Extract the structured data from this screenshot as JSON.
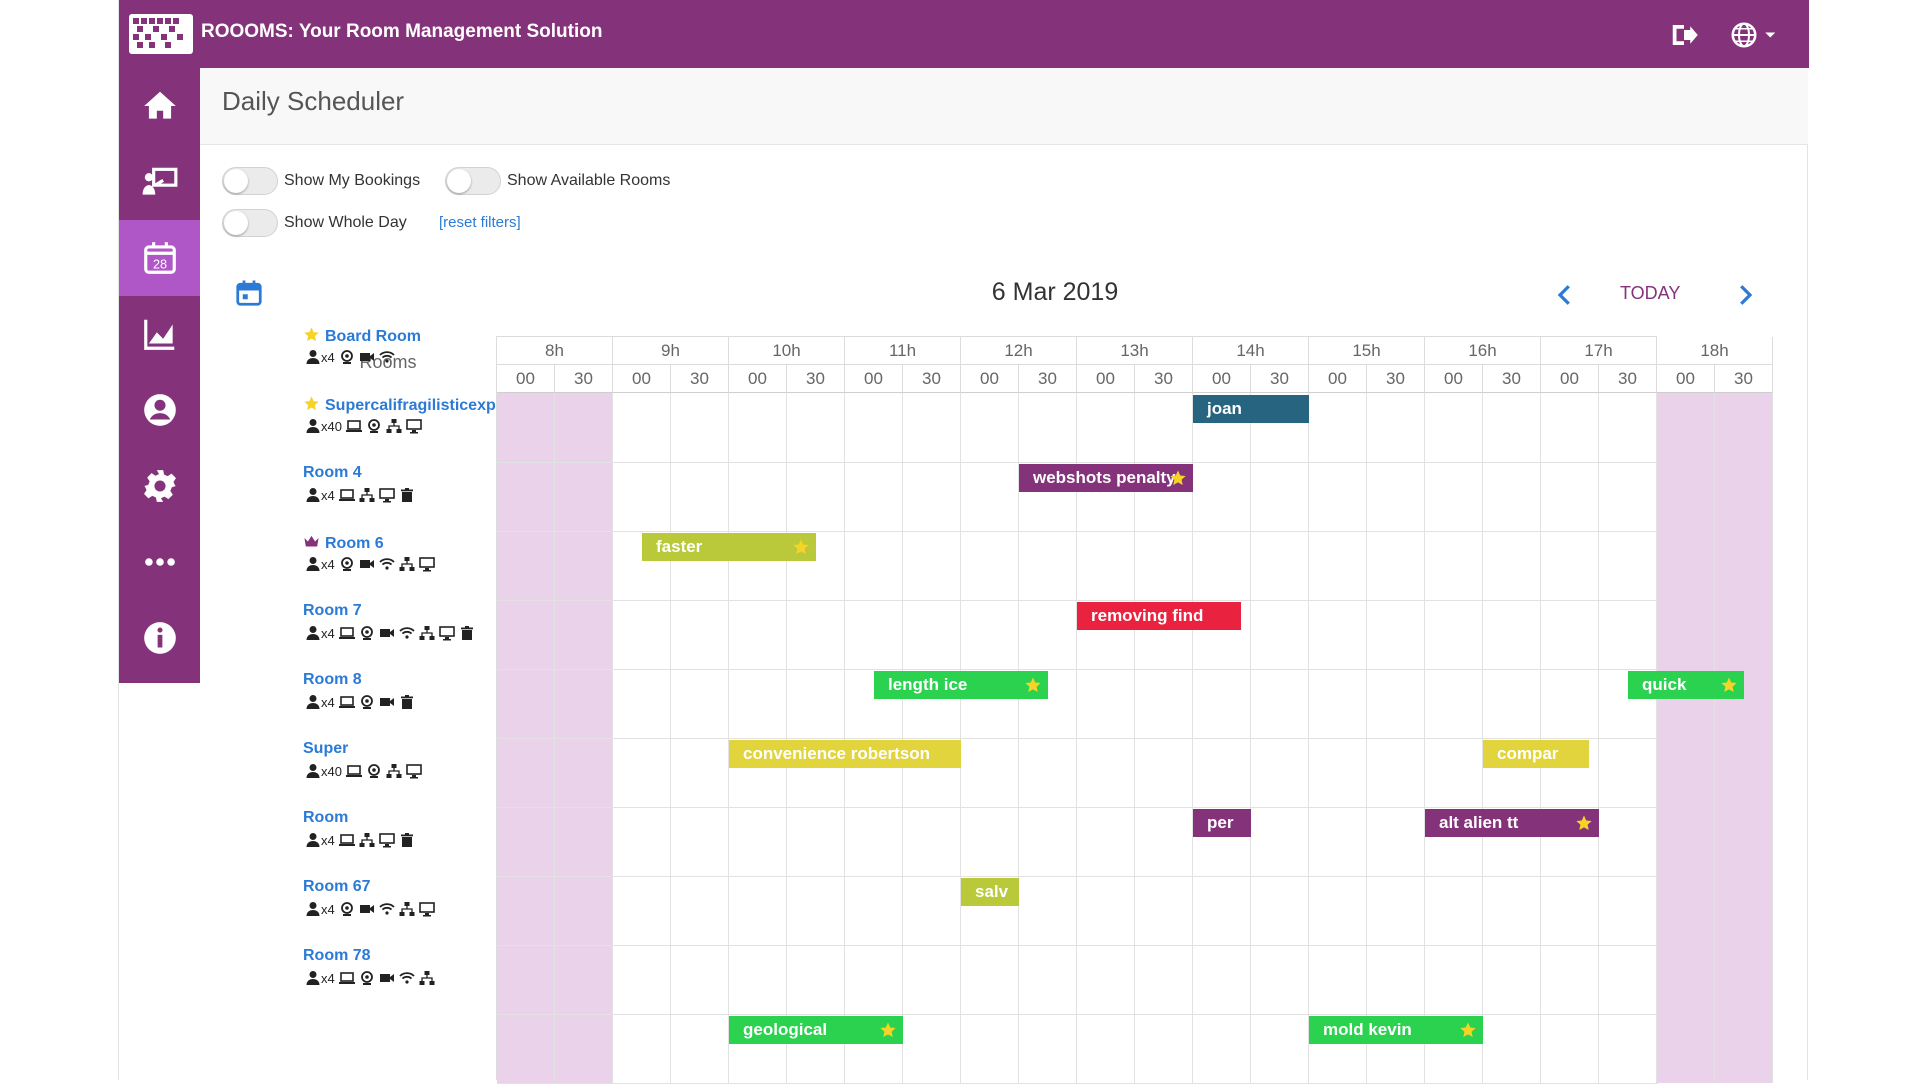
{
  "app": {
    "title": "ROOOMS: Your Room Management Solution"
  },
  "page": {
    "title": "Daily Scheduler"
  },
  "filters": {
    "show_my_bookings": "Show My Bookings",
    "show_available_rooms": "Show Available Rooms",
    "show_whole_day": "Show Whole Day",
    "reset": "[reset filters]"
  },
  "date": "6 Mar 2019",
  "nav": {
    "today": "TODAY",
    "calendar_day": "28"
  },
  "schedule": {
    "rooms_header": "Rooms",
    "hours": [
      "8h",
      "9h",
      "10h",
      "11h",
      "12h",
      "13h",
      "14h",
      "15h",
      "16h",
      "17h",
      "18h"
    ],
    "minutes": [
      "00",
      "30"
    ]
  },
  "rooms": [
    {
      "name": "Board Room",
      "capacity": "x4",
      "marker": "star",
      "features": [
        "webcam",
        "video",
        "wifi"
      ]
    },
    {
      "name": "Supercalifragilisticexpiali...",
      "capacity": "x40",
      "marker": "star",
      "features": [
        "laptop",
        "webcam",
        "network",
        "monitor"
      ]
    },
    {
      "name": "Room 4",
      "capacity": "x4",
      "marker": "",
      "features": [
        "laptop",
        "network",
        "monitor",
        "trash"
      ]
    },
    {
      "name": "Room 6",
      "capacity": "x4",
      "marker": "crown",
      "features": [
        "webcam",
        "video",
        "wifi",
        "network",
        "monitor"
      ]
    },
    {
      "name": "Room 7",
      "capacity": "x4",
      "marker": "",
      "features": [
        "laptop",
        "webcam",
        "video",
        "wifi",
        "network",
        "monitor",
        "trash"
      ]
    },
    {
      "name": "Room 8",
      "capacity": "x4",
      "marker": "",
      "features": [
        "laptop",
        "webcam",
        "video",
        "trash"
      ]
    },
    {
      "name": "Super",
      "capacity": "x40",
      "marker": "",
      "features": [
        "laptop",
        "webcam",
        "network",
        "monitor"
      ]
    },
    {
      "name": "Room",
      "capacity": "x4",
      "marker": "",
      "features": [
        "laptop",
        "network",
        "monitor",
        "trash"
      ]
    },
    {
      "name": "Room 67",
      "capacity": "x4",
      "marker": "",
      "features": [
        "webcam",
        "video",
        "wifi",
        "network",
        "monitor"
      ]
    },
    {
      "name": "Room 78",
      "capacity": "x4",
      "marker": "",
      "features": [
        "laptop",
        "webcam",
        "video",
        "wifi",
        "network"
      ]
    }
  ],
  "bookings": [
    {
      "room": 0,
      "label": "joan",
      "start": "14:00",
      "end": "15:00",
      "color": "#276480",
      "star": false
    },
    {
      "room": 1,
      "label": "webshots penalty",
      "start": "12:30",
      "end": "14:00",
      "color": "#84337b",
      "star": true
    },
    {
      "room": 2,
      "label": "faster",
      "start": "9:15",
      "end": "10:45",
      "color": "#b9c93a",
      "star": true
    },
    {
      "room": 3,
      "label": "removing find",
      "start": "13:00",
      "end": "14:25",
      "color": "#e8223f",
      "star": false
    },
    {
      "room": 4,
      "label": "length ice",
      "start": "11:15",
      "end": "12:45",
      "color": "#2ad24f",
      "star": true
    },
    {
      "room": 4,
      "label": "quick",
      "start": "17:45",
      "end": "18:45",
      "color": "#2ad24f",
      "star": true
    },
    {
      "room": 5,
      "label": "convenience robertson",
      "start": "10:00",
      "end": "12:00",
      "color": "#e2d43d",
      "star": false
    },
    {
      "room": 5,
      "label": "compar",
      "start": "16:30",
      "end": "17:25",
      "color": "#e2d43d",
      "star": false
    },
    {
      "room": 6,
      "label": "per",
      "start": "14:00",
      "end": "14:30",
      "color": "#84337b",
      "star": false
    },
    {
      "room": 6,
      "label": "alt alien tt",
      "start": "16:00",
      "end": "17:30",
      "color": "#84337b",
      "star": true
    },
    {
      "room": 7,
      "label": "salv",
      "start": "12:00",
      "end": "12:30",
      "color": "#b9c93a",
      "star": false
    },
    {
      "room": 9,
      "label": "geological",
      "start": "10:00",
      "end": "11:30",
      "color": "#2ad24f",
      "star": true
    },
    {
      "room": 9,
      "label": "mold kevin",
      "start": "15:00",
      "end": "16:30",
      "color": "#2ad24f",
      "star": true
    }
  ],
  "colors": {
    "brand": "#84337b",
    "active_nav": "#b057c8",
    "link": "#2b7bd6",
    "offhours": "#ead3ea",
    "star": "#f5d327"
  },
  "sidebar_icons": [
    "home-icon",
    "presentation-icon",
    "calendar-icon",
    "chart-icon",
    "user-icon",
    "gear-icon",
    "more-icon",
    "info-icon"
  ]
}
